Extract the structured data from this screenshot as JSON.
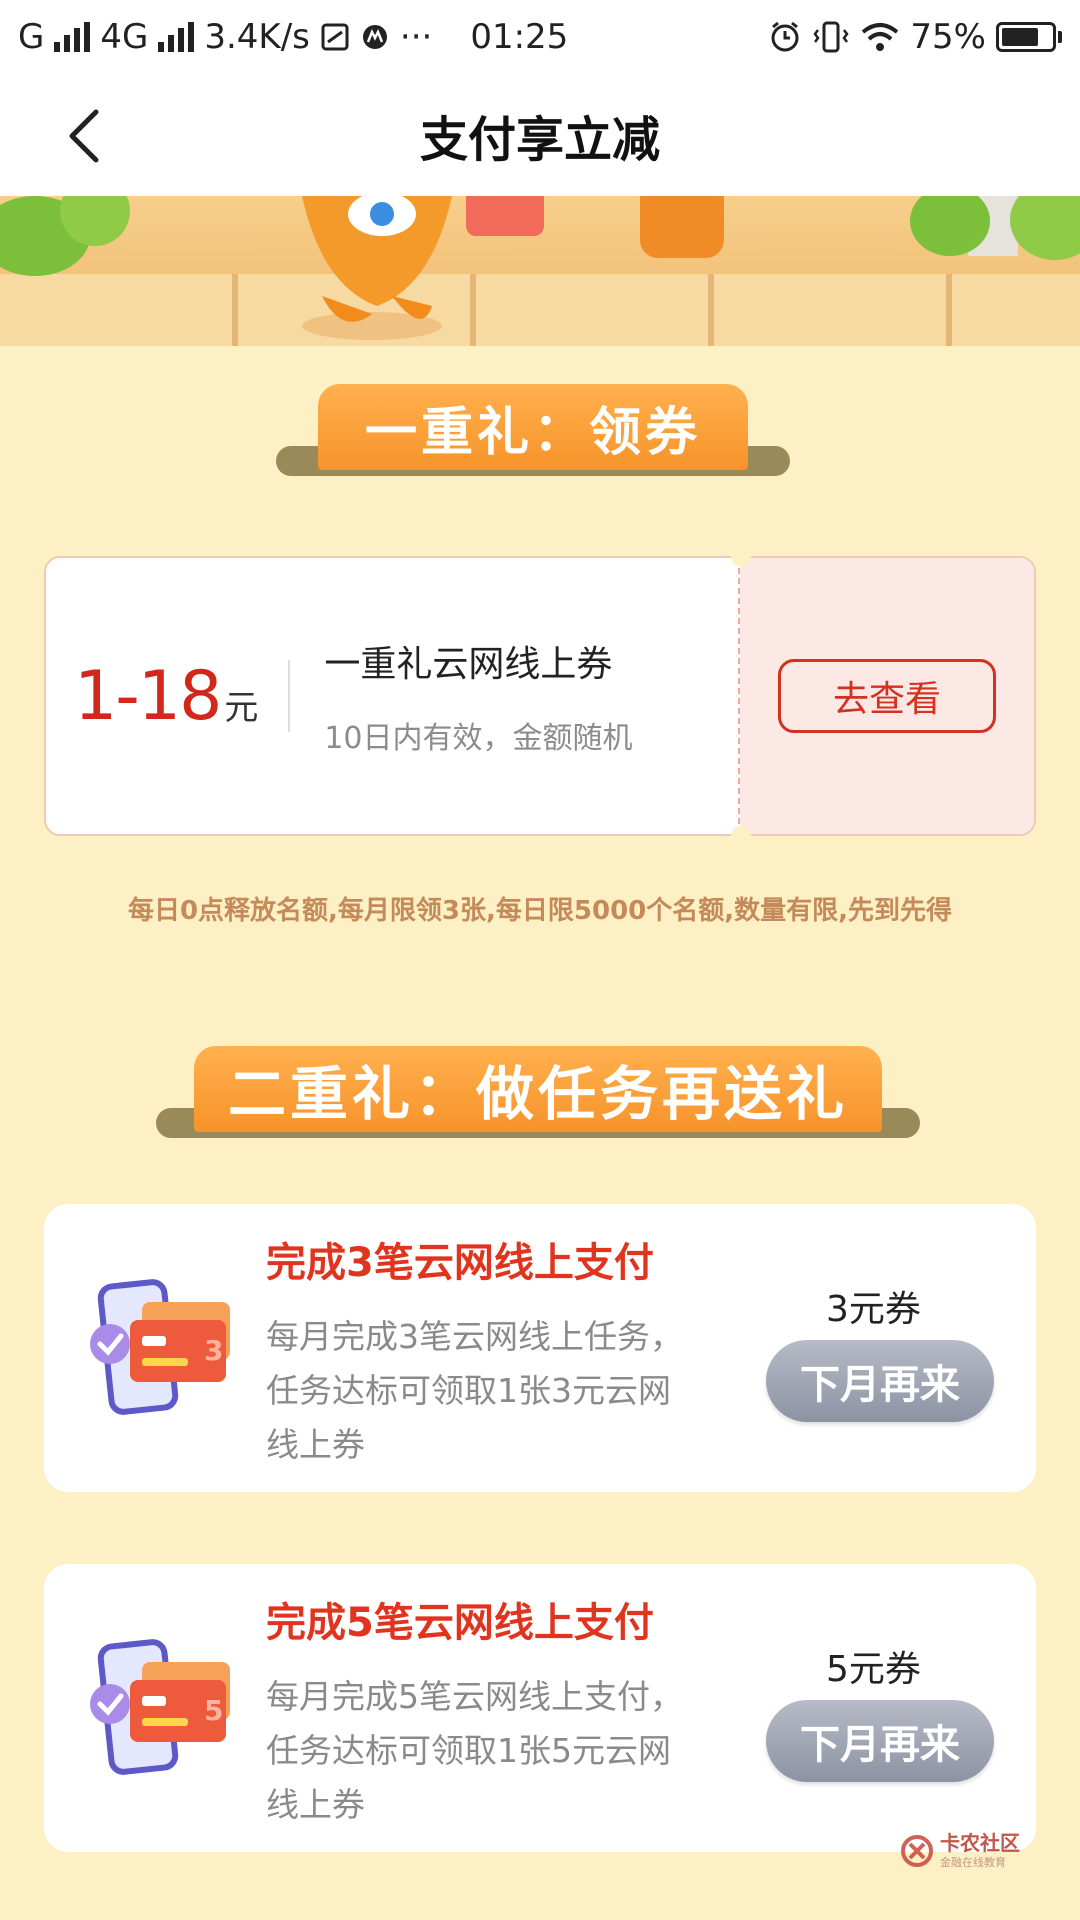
{
  "status_bar": {
    "carrier_text": "G",
    "network_text": "4G",
    "speed": "3.4K/s",
    "time": "01:25",
    "battery": "75%",
    "battery_level": 0.75
  },
  "nav": {
    "title": "支付享立减"
  },
  "section1": {
    "heading": "一重礼：领券",
    "coupon": {
      "amount": "1-18",
      "unit": "元",
      "name": "一重礼云网线上券",
      "desc": "10日内有效，金额随机",
      "button": "去查看"
    },
    "notice": "每日0点释放名额,每月限领3张,每日限5000个名额,数量有限,先到先得"
  },
  "section2": {
    "heading": "二重礼：做任务再送礼",
    "tasks": [
      {
        "title": "完成3笔云网线上支付",
        "desc": "每月完成3笔云网线上任务，任务达标可领取1张3元云网线上券",
        "reward": "3元券",
        "button": "下月再来",
        "badge": "3"
      },
      {
        "title": "完成5笔云网线上支付",
        "desc": "每月完成5笔云网线上支付，任务达标可领取1张5元云网线上券",
        "reward": "5元券",
        "button": "下月再来",
        "badge": "5"
      }
    ]
  },
  "watermark": {
    "name": "卡农社区",
    "sub": "金融在线教育"
  },
  "colors": {
    "page_bg": "#fdf0c4",
    "accent_red": "#d2281c",
    "ribbon_orange": "#f7932a",
    "disabled_button": "#9aa0ad"
  },
  "icons": [
    "back-arrow-icon",
    "signal-icon",
    "alarm-icon",
    "vibrate-icon",
    "wifi-icon",
    "battery-icon",
    "check-badge-icon",
    "card-icon"
  ]
}
